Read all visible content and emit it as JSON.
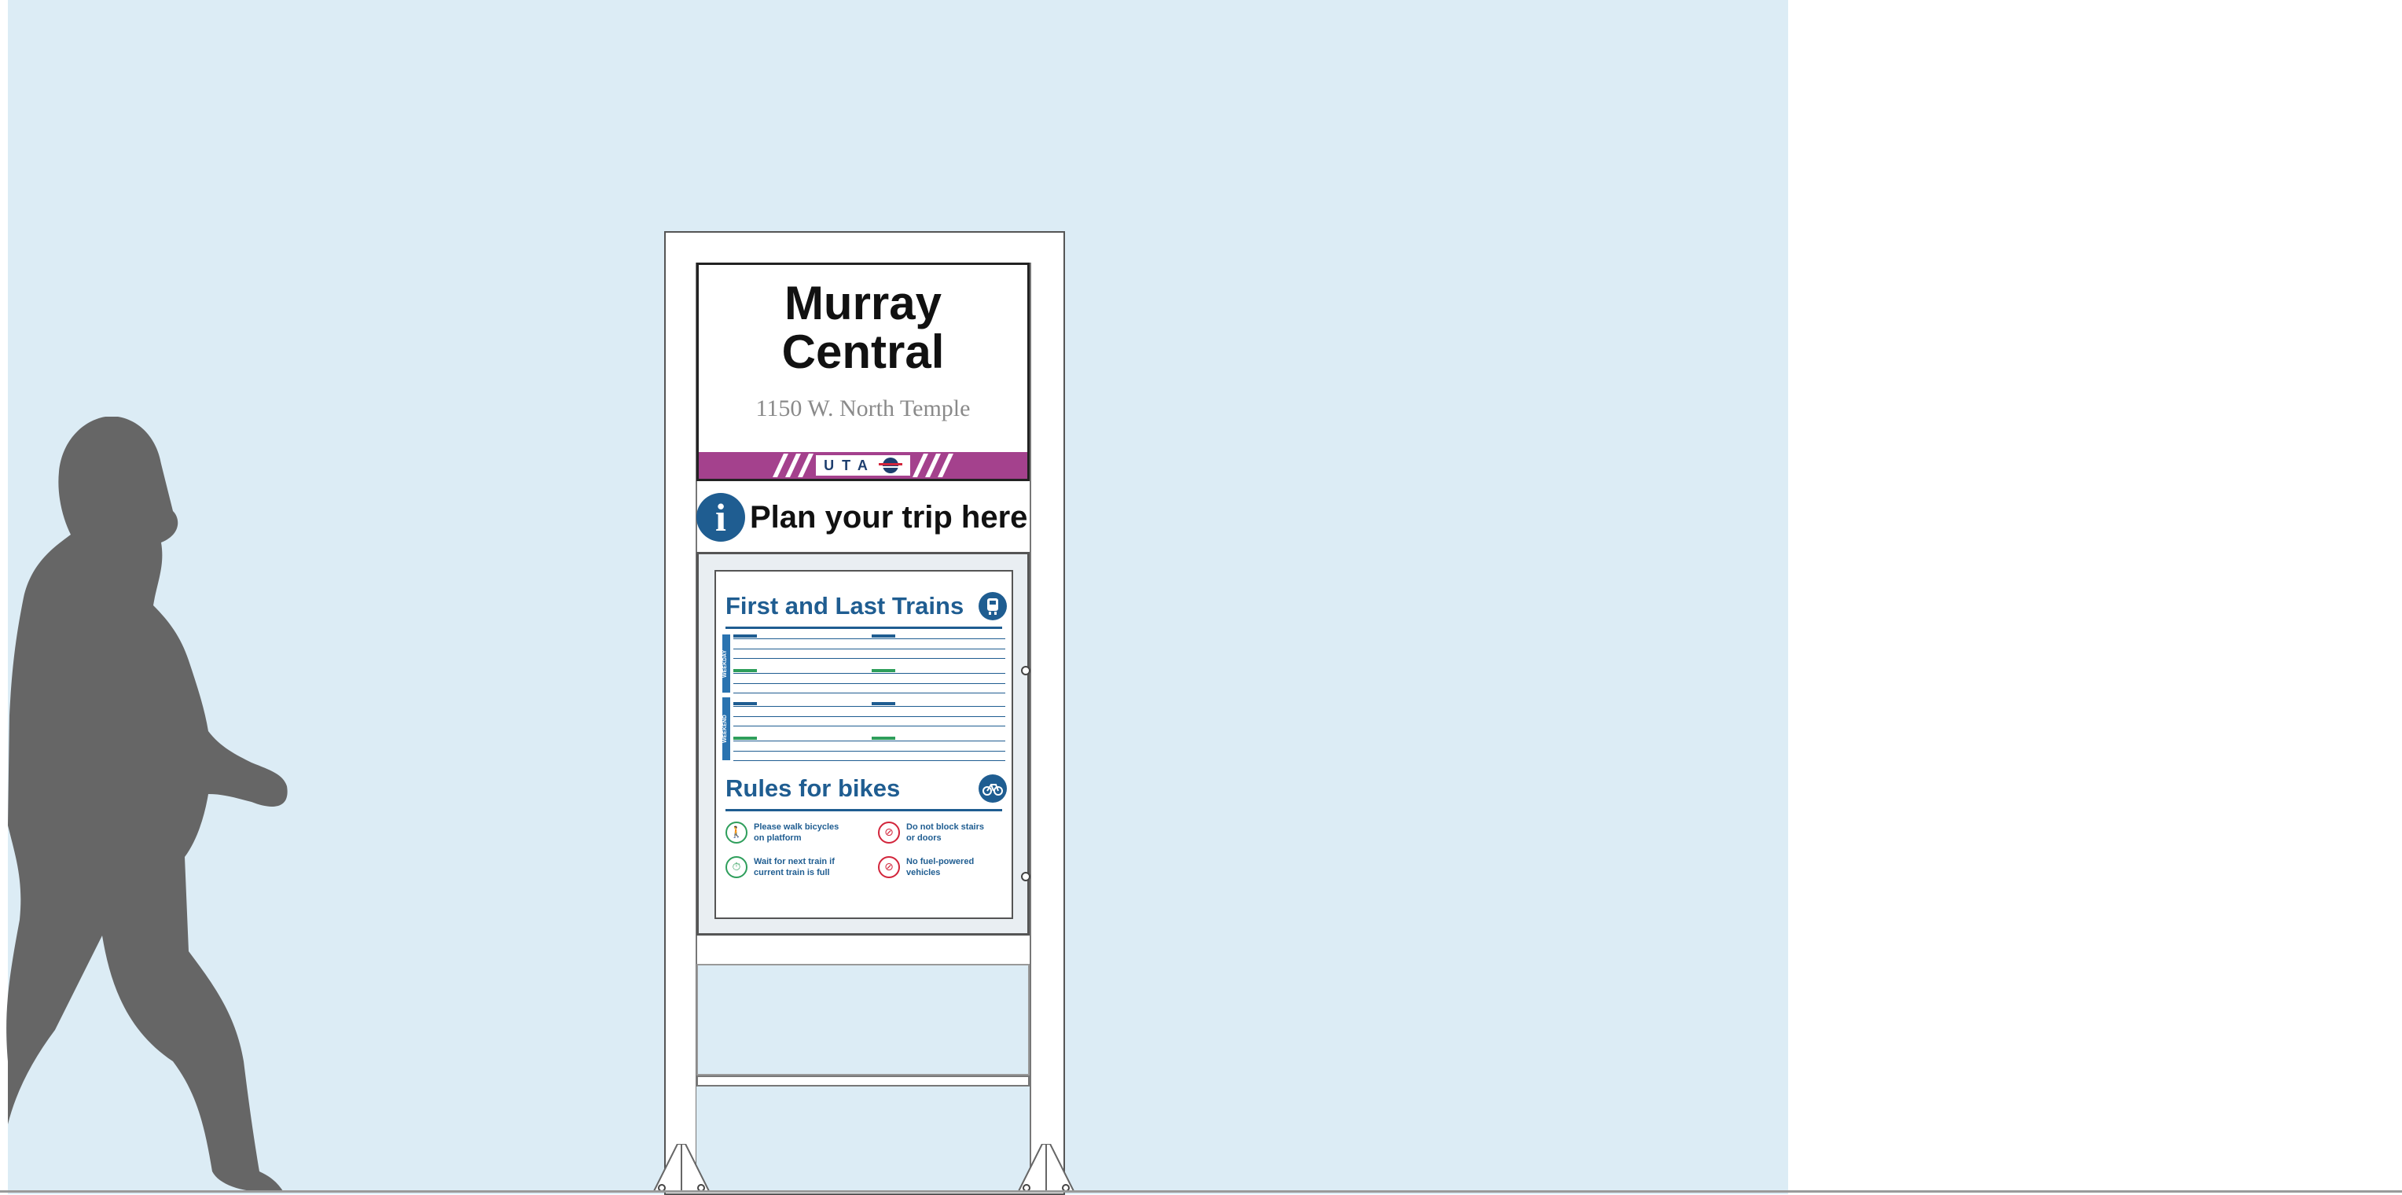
{
  "sign": {
    "station_name": "Murray\nCentral",
    "address": "1150 W. North Temple",
    "brand": "UTA",
    "plan_text": "Plan your trip here",
    "info_glyph": "i"
  },
  "poster": {
    "trains_title": "First and Last Trains",
    "bikes_title": "Rules for bikes",
    "weekday_tab": "WEEKDAY",
    "weekend_tab": "WEEKEND",
    "rules": [
      {
        "text": "Please walk bicycles\non platform",
        "icon": "walk-bike-icon",
        "color": "#2e9e5b"
      },
      {
        "text": "Do not block stairs\nor doors",
        "icon": "no-block-icon",
        "color": "#d2253b"
      },
      {
        "text": "Wait for next train if\ncurrent train is full",
        "icon": "wait-train-icon",
        "color": "#2e9e5b"
      },
      {
        "text": "No fuel-powered\nvehicles",
        "icon": "no-fuel-icon",
        "color": "#d2253b"
      }
    ]
  },
  "colors": {
    "sky": "#dcecf5",
    "brand_purple": "#a4418d",
    "uta_blue": "#1f5d91",
    "green": "#2e9e5b",
    "red": "#d2253b"
  }
}
